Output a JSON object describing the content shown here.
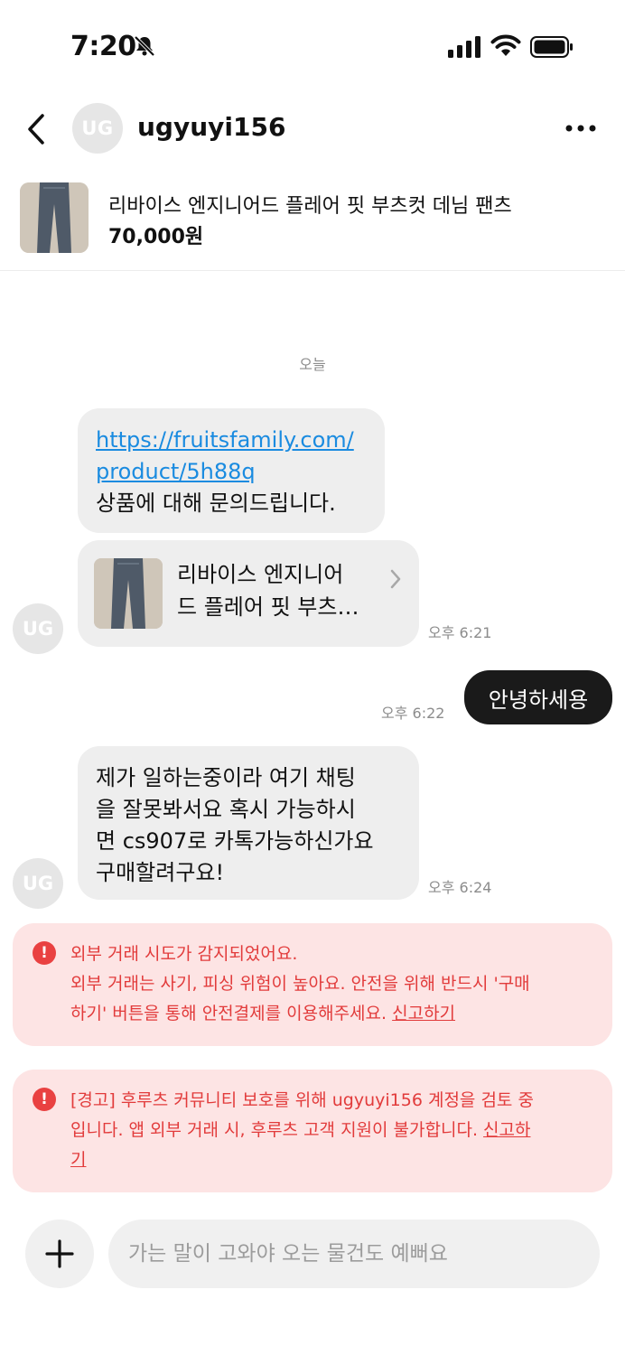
{
  "status": {
    "time": "7:20"
  },
  "header": {
    "avatar_initials": "UG",
    "username": "ugyuyi156"
  },
  "product": {
    "title": "리바이스 엔지니어드 플레어 핏 부츠컷 데님 팬츠",
    "price": "70,000원"
  },
  "chat": {
    "date_label": "오늘",
    "msg1": {
      "link_line1": "https://fruitsfamily.com/",
      "link_line2": "product/5h88q",
      "text": "상품에 대해 문의드립니다."
    },
    "card": {
      "line1": "리바이스 엔지니어",
      "line2": "드 플레어 핏 부츠…"
    },
    "msg1_time": "오후 6:21",
    "out_msg": {
      "text": "안녕하세용",
      "time": "오후 6:22"
    },
    "msg2": {
      "line1": "제가 일하는중이라 여기 채팅",
      "line2": "을 잘못봐서요 혹시 가능하시",
      "line3": "면 cs907로 카톡가능하신가요",
      "line4": "구매할려구요!",
      "time": "오후 6:24"
    },
    "avatar_initials": "UG"
  },
  "warnings": [
    {
      "icon": "!",
      "line1": "외부 거래 시도가 감지되었어요.",
      "line2": "외부 거래는 사기, 피싱 위험이 높아요. 안전을 위해 반드시 '구매",
      "line3": "하기' 버튼을 통해 안전결제를 이용해주세요.",
      "report": "신고하기"
    },
    {
      "icon": "!",
      "line1": "[경고] 후루츠 커뮤니티 보호를 위해 ugyuyi156 계정을 검토 중",
      "line2": "입니다. 앱 외부 거래 시, 후루츠 고객 지원이 불가합니다.",
      "report_part1": "신고하",
      "report_part2": "기"
    }
  ],
  "composer": {
    "placeholder": "가는 말이 고와야 오는 물건도 예뻐요"
  }
}
